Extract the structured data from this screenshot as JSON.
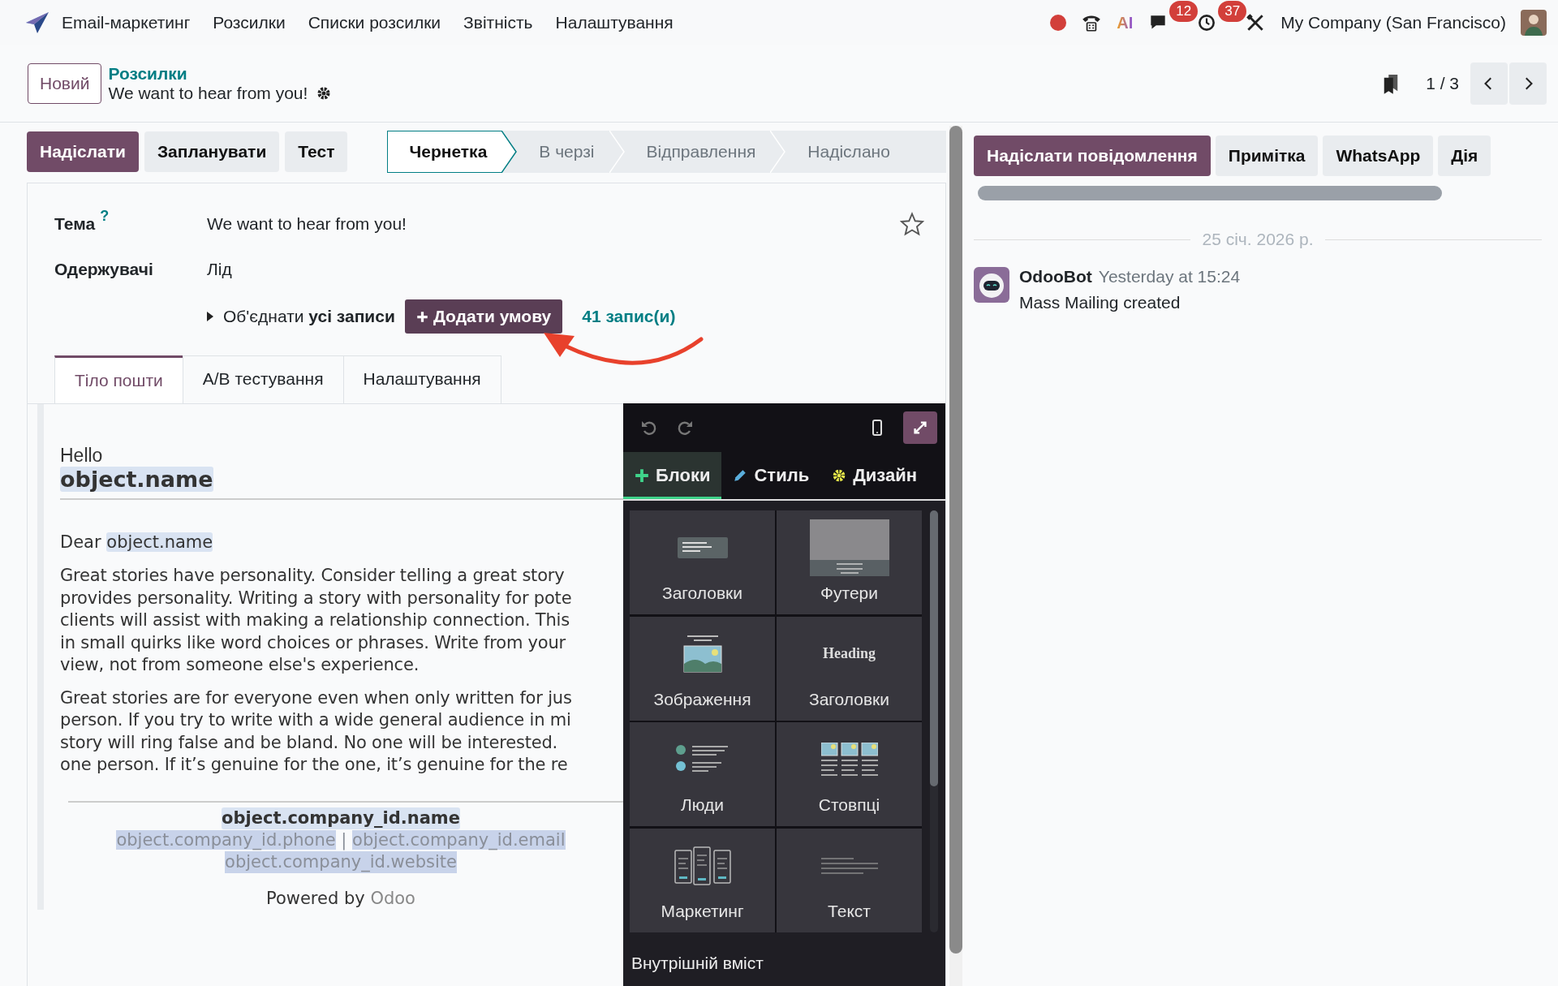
{
  "top_nav": {
    "app_name": "Email-маркетинг",
    "menu": [
      "Розсилки",
      "Списки розсилки",
      "Звітність",
      "Налаштування"
    ],
    "ai_label": "AI",
    "message_count": "12",
    "activity_count": "37",
    "company": "My Company (San Francisco)"
  },
  "control_panel": {
    "new_button": "Новий",
    "breadcrumb": "Розсилки",
    "title": "We want to hear from you!",
    "pager": "1 / 3"
  },
  "actions": [
    {
      "label": "Надіслати",
      "kind": "primary"
    },
    {
      "label": "Запланувати",
      "kind": "secondary"
    },
    {
      "label": "Тест",
      "kind": "secondary"
    }
  ],
  "status_steps": [
    {
      "label": "Чернетка",
      "selected": true
    },
    {
      "label": "В черзі",
      "selected": false
    },
    {
      "label": "Відправлення",
      "selected": false
    },
    {
      "label": "Надіслано",
      "selected": false
    }
  ],
  "form": {
    "starred": false,
    "fields": [
      {
        "label": "Тема",
        "help": "?",
        "value": "We want to hear from you!"
      },
      {
        "label": "Одержувачі",
        "value": "Лід"
      }
    ],
    "domain": {
      "text": "Об'єднати **усі записи**",
      "add_button": "Додати умову",
      "count": "41 запис(и)"
    }
  },
  "tabs": [
    {
      "label": "Тіло пошти",
      "selected": true
    },
    {
      "label": "A/B тестування",
      "selected": false
    },
    {
      "label": "Налаштування",
      "selected": false
    }
  ],
  "email_body": {
    "greeting": "Hello",
    "name_placeholder": "object.name",
    "salutation": "Dear",
    "salutation_placeholder": "object.name",
    "paragraphs": [
      [
        "Great stories have personality. Consider telling a great story",
        "provides personality. Writing a story with personality for pote",
        "clients will assist with making a relationship connection. This",
        "in small quirks like word choices or phrases. Write from your",
        "view, not from someone else's experience."
      ],
      [
        "Great stories are for everyone even when only written for jus",
        "person. If you try to write with a wide general audience in mi",
        "story will ring false and be bland. No one will be interested.",
        "one person. If it’s genuine for the one, it’s genuine for the re"
      ]
    ],
    "company_name": "object.company_id.name",
    "phone": "object.company_id.phone",
    "separator": "|",
    "email": "object.company_id.email",
    "website": "object.company_id.website",
    "powered_by": "Powered by",
    "powered_link": "Odoo"
  },
  "editor": {
    "tabs": [
      {
        "label": "Блоки",
        "kind": "blocks",
        "selected": true
      },
      {
        "label": "Стиль",
        "kind": "style",
        "selected": false
      },
      {
        "label": "Дизайн",
        "kind": "design",
        "selected": false
      }
    ],
    "blocks": [
      {
        "label": "Заголовки",
        "kind": "headers"
      },
      {
        "label": "Футери",
        "kind": "footers"
      },
      {
        "label": "Зображення",
        "kind": "images"
      },
      {
        "label": "Заголовки",
        "kind": "titles",
        "preview_text": "Heading"
      },
      {
        "label": "Люди",
        "kind": "people"
      },
      {
        "label": "Стовпці",
        "kind": "columns"
      },
      {
        "label": "Маркетинг",
        "kind": "marketing"
      },
      {
        "label": "Текст",
        "kind": "text"
      }
    ],
    "section": "Внутрішній вміст"
  },
  "chatter": {
    "buttons": [
      {
        "label": "Надіслати повідомлення",
        "kind": "primary"
      },
      {
        "label": "Примітка",
        "kind": "secondary"
      },
      {
        "label": "WhatsApp",
        "kind": "secondary"
      },
      {
        "label": "Дія",
        "kind": "secondary"
      }
    ],
    "date": "25 січ. 2026 р.",
    "messages": [
      {
        "author": "OdooBot",
        "time": "Yesterday at 15:24",
        "body": "Mass Mailing created"
      }
    ]
  }
}
